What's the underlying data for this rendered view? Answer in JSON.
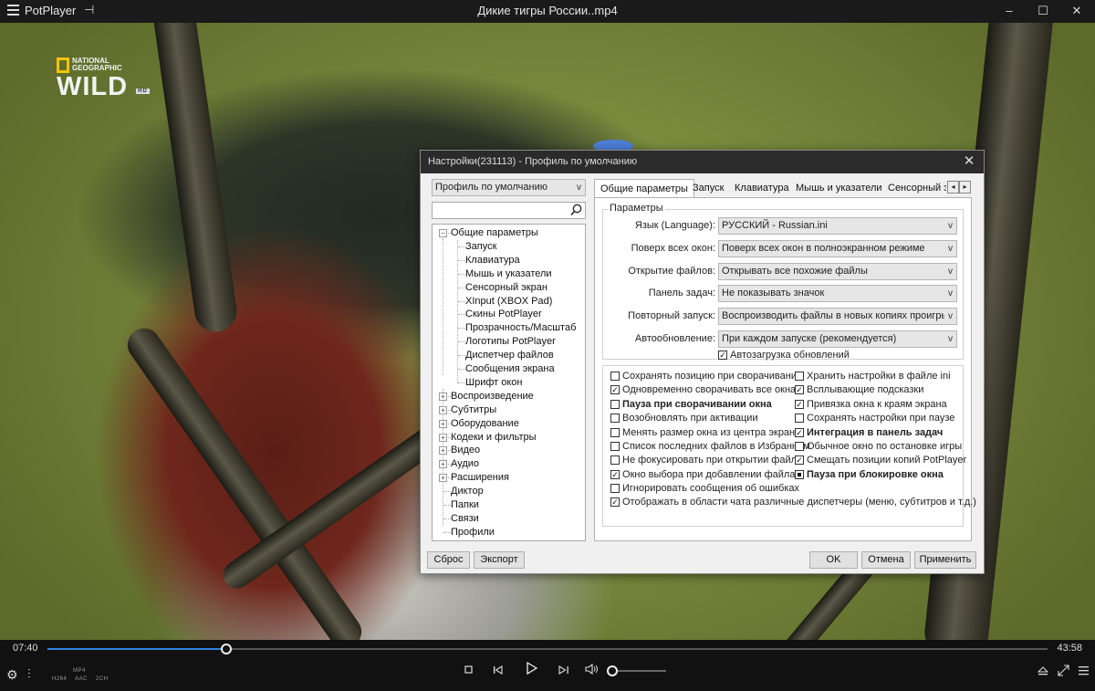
{
  "titlebar": {
    "app_name": "PotPlayer",
    "file_name": "Дикие тигры России..mp4",
    "pin_icon": "pin-icon",
    "minimize": "–",
    "maximize": "☐",
    "close": "✕"
  },
  "video": {
    "logo_top": "NATIONAL GEOGRAPHIC",
    "logo_main": "WILD",
    "logo_hd": "HD"
  },
  "playback": {
    "time_elapsed": "07:40",
    "time_total": "43:58",
    "progress_fraction": 0.179,
    "codec_video": "H264",
    "codec_container": "MP4",
    "codec_audio": "AAC",
    "codec_channels": "2CH",
    "volume_fraction": 0.0,
    "accent_color": "#2f83e0"
  },
  "dialog": {
    "title": "Настройки(231113) - Профиль по умолчанию",
    "profile_selected": "Профиль по умолчанию",
    "search_value": "",
    "tree": [
      {
        "label": "Общие параметры",
        "expanded": true
      },
      {
        "label": "Запуск"
      },
      {
        "label": "Клавиатура"
      },
      {
        "label": "Мышь и указатели"
      },
      {
        "label": "Сенсорный экран"
      },
      {
        "label": "XInput (XBOX Pad)"
      },
      {
        "label": "Скины PotPlayer"
      },
      {
        "label": "Прозрачность/Масштаб"
      },
      {
        "label": "Логотипы PotPlayer"
      },
      {
        "label": "Диспетчер файлов"
      },
      {
        "label": "Сообщения экрана"
      },
      {
        "label": "Шрифт окон"
      },
      {
        "label": "Воспроизведение"
      },
      {
        "label": "Субтитры"
      },
      {
        "label": "Оборудование"
      },
      {
        "label": "Кодеки и фильтры"
      },
      {
        "label": "Видео"
      },
      {
        "label": "Аудио"
      },
      {
        "label": "Расширения"
      },
      {
        "label": "Диктор"
      },
      {
        "label": "Папки"
      },
      {
        "label": "Связи"
      },
      {
        "label": "Профили"
      }
    ],
    "tabs": [
      "Общие параметры",
      "Запуск",
      "Клавиатура",
      "Мышь и указатели",
      "Сенсорный эк"
    ],
    "group_label": "Параметры",
    "settings": [
      {
        "label": "Язык (Language):",
        "value": "РУССКИЙ - Russian.ini"
      },
      {
        "label": "Поверх всех окон:",
        "value": "Поверх всех окон в полноэкранном режиме"
      },
      {
        "label": "Открытие файлов:",
        "value": "Открывать все похожие файлы"
      },
      {
        "label": "Панель задач:",
        "value": "Не показывать значок"
      },
      {
        "label": "Повторный запуск:",
        "value": "Воспроизводить файлы в новых копиях проигрыват"
      },
      {
        "label": "Автообновление:",
        "value": "При каждом запуске (рекомендуется)"
      }
    ],
    "autoload_updates": {
      "label": "Автозагрузка обновлений",
      "checked": true
    },
    "checks_left": [
      {
        "label": "Сохранять позицию при сворачивании",
        "checked": false
      },
      {
        "label": "Одновременно сворачивать все окна",
        "checked": true
      },
      {
        "label": "Пауза при сворачивании окна",
        "checked": false,
        "bold": true
      },
      {
        "label": "Возобновлять при активации",
        "checked": false
      },
      {
        "label": "Менять размер окна из центра экрана",
        "checked": false
      },
      {
        "label": "Список последних файлов в Избранном",
        "checked": false
      },
      {
        "label": "Не фокусировать при открытии файла",
        "checked": false
      },
      {
        "label": "Окно выбора при добавлении файла",
        "checked": true
      }
    ],
    "checks_right": [
      {
        "label": "Хранить настройки в файле ini",
        "checked": false
      },
      {
        "label": "Всплывающие подсказки",
        "checked": true
      },
      {
        "label": "Привязка окна к краям экрана",
        "checked": true
      },
      {
        "label": "Сохранять настройки при паузе",
        "checked": false
      },
      {
        "label": "Интеграция в панель задач",
        "checked": true,
        "bold": true
      },
      {
        "label": "Обычное окно по остановке игры",
        "checked": false
      },
      {
        "label": "Смещать позиции копий PotPlayer",
        "checked": true
      },
      {
        "label": "Пауза при блокировке окна",
        "checked": "indeterminate",
        "bold": true
      }
    ],
    "checks_wide": [
      {
        "label": "Игнорировать сообщения об ошибках",
        "checked": false
      },
      {
        "label": "Отображать в области чата различные диспетчеры (меню, субтитров и т.д.)",
        "checked": true
      }
    ],
    "buttons": {
      "reset": "Сброс",
      "export": "Экспорт",
      "ok": "OK",
      "cancel": "Отмена",
      "apply": "Применить"
    }
  }
}
